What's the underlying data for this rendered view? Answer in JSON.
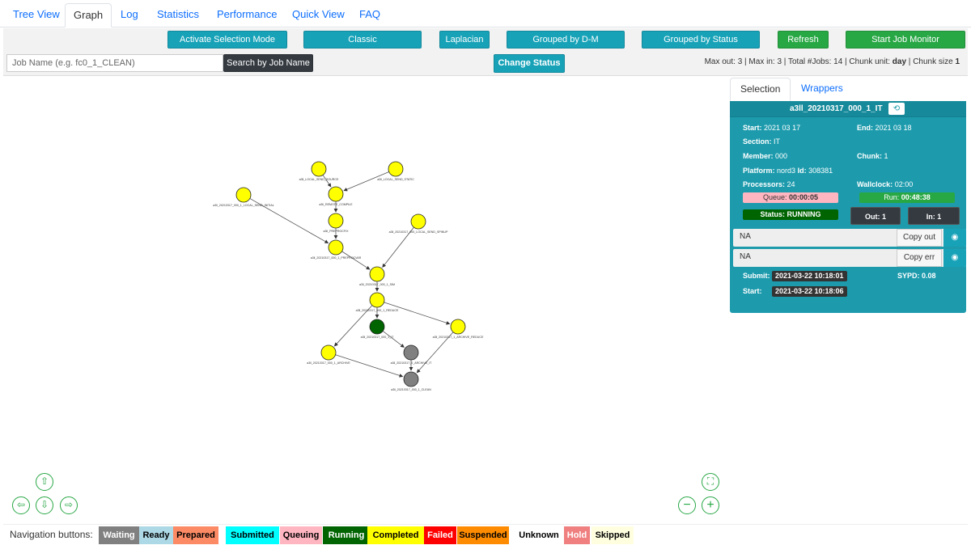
{
  "tabs": [
    "Tree View",
    "Graph",
    "Log",
    "Statistics",
    "Performance",
    "Quick View",
    "FAQ"
  ],
  "toolbar": {
    "activate_selection": "Activate Selection Mode",
    "classic": "Classic",
    "laplacian": "Laplacian",
    "grouped_dm": "Grouped by D-M",
    "grouped_status": "Grouped by Status",
    "refresh": "Refresh",
    "start_monitor": "Start Job Monitor"
  },
  "search": {
    "placeholder": "Job Name (e.g. fc0_1_CLEAN)",
    "button": "Search by Job Name",
    "change_status": "Change Status"
  },
  "info": {
    "max_out_label": "Max out:",
    "max_out": "3",
    "max_in_label": "Max in:",
    "max_in": "3",
    "total_label": "Total #Jobs:",
    "total": "14",
    "chunk_unit_label": "Chunk unit:",
    "chunk_unit": "day",
    "chunk_size_label": "Chunk size",
    "chunk_size": "1"
  },
  "side_tabs": [
    "Selection",
    "Wrappers"
  ],
  "selection": {
    "job_name": "a3ll_20210317_000_1_IT",
    "history_icon": "history-icon",
    "start_label": "Start:",
    "start": "2021 03 17",
    "end_label": "End:",
    "end": "2021 03 18",
    "section_label": "Section:",
    "section": "IT",
    "member_label": "Member:",
    "member": "000",
    "chunk_label": "Chunk:",
    "chunk": "1",
    "platform_label": "Platform:",
    "platform": "nord3",
    "id_label": "Id:",
    "id": "308381",
    "processors_label": "Processors:",
    "processors": "24",
    "wallclock_label": "Wallclock:",
    "wallclock": "02:00",
    "queue_label": "Queue:",
    "queue": "00:00:05",
    "run_label": "Run:",
    "run": "00:48:38",
    "status_label": "Status:",
    "status": "RUNNING",
    "out_label": "Out:",
    "out": "1",
    "in_label": "In:",
    "in": "1",
    "out_file": "NA",
    "copy_out": "Copy out",
    "err_file": "NA",
    "copy_err": "Copy err",
    "submit_label": "Submit:",
    "submit": "2021-03-22 10:18:01",
    "start_time_label": "Start:",
    "start_time": "2021-03-22 10:18:06",
    "sypd_label": "SYPD:",
    "sypd": "0.08"
  },
  "graph": {
    "nodes": [
      {
        "id": "n1",
        "label": "a3ll_LOCAL_SEND_SOURCE",
        "color": "#ffff00"
      },
      {
        "id": "n2",
        "label": "a3ll_LOCAL_SEND_STATIC",
        "color": "#ffff00"
      },
      {
        "id": "n3",
        "label": "a3ll_20210317_000_1_LOCAL_SEND_INITIAL",
        "color": "#ffff00"
      },
      {
        "id": "n4",
        "label": "a3ll_REMOTE_COMPILE",
        "color": "#ffff00"
      },
      {
        "id": "n5",
        "label": "a3ll_PREPROCFIX",
        "color": "#ffff00"
      },
      {
        "id": "n6",
        "label": "a3ll_20210317_000_LOCAL_SEND_SPINUP",
        "color": "#ffff00"
      },
      {
        "id": "n7",
        "label": "a3ll_20210317_000_1_PREPROCVAR",
        "color": "#ffff00"
      },
      {
        "id": "n8",
        "label": "a3ll_20210317_000_1_SIM",
        "color": "#ffff00"
      },
      {
        "id": "n9",
        "label": "a3ll_20210317_000_1_REDUCE",
        "color": "#ffff00"
      },
      {
        "id": "n10",
        "label": "a3ll_20210317_000_1_IT",
        "color": "#006400"
      },
      {
        "id": "n11",
        "label": "a3ll_20210317_1_ARCHIVE_REDUCE",
        "color": "#ffff00"
      },
      {
        "id": "n12",
        "label": "a3ll_20210317_000_1_ARCHIVE",
        "color": "#ffff00"
      },
      {
        "id": "n13",
        "label": "a3ll_20210317_0_ARCHIVE_IT",
        "color": "#808080"
      },
      {
        "id": "n14",
        "label": "a3ll_20210317_000_1_CLEAN",
        "color": "#808080"
      }
    ],
    "edges": [
      [
        "n1",
        "n4"
      ],
      [
        "n2",
        "n4"
      ],
      [
        "n4",
        "n5"
      ],
      [
        "n3",
        "n7"
      ],
      [
        "n5",
        "n7"
      ],
      [
        "n7",
        "n8"
      ],
      [
        "n6",
        "n8"
      ],
      [
        "n8",
        "n9"
      ],
      [
        "n9",
        "n10"
      ],
      [
        "n9",
        "n11"
      ],
      [
        "n9",
        "n12"
      ],
      [
        "n10",
        "n13"
      ],
      [
        "n12",
        "n14"
      ],
      [
        "n13",
        "n14"
      ],
      [
        "n11",
        "n14"
      ]
    ]
  },
  "nav": {
    "up_icon": "arrow-up-icon",
    "left_icon": "arrow-left-icon",
    "down_icon": "arrow-down-icon",
    "right_icon": "arrow-right-icon",
    "fit_icon": "fit-view-icon",
    "zoom_out_icon": "zoom-out-icon",
    "zoom_in_icon": "zoom-in-icon"
  },
  "legend": {
    "label": "Navigation buttons:",
    "statuses": [
      {
        "name": "Waiting",
        "bg": "#808080",
        "fg": "#ffffff"
      },
      {
        "name": "Ready",
        "bg": "#add8e6",
        "fg": "#000000"
      },
      {
        "name": "Prepared",
        "bg": "#fc8a64",
        "fg": "#000000"
      },
      {
        "name": "Submitted",
        "bg": "#00ffff",
        "fg": "#000000"
      },
      {
        "name": "Queuing",
        "bg": "#ffb6c1",
        "fg": "#000000"
      },
      {
        "name": "Running",
        "bg": "#006400",
        "fg": "#ffffff"
      },
      {
        "name": "Completed",
        "bg": "#ffff00",
        "fg": "#000000"
      },
      {
        "name": "Failed",
        "bg": "#ff0000",
        "fg": "#ffffff"
      },
      {
        "name": "Suspended",
        "bg": "#ff8c00",
        "fg": "#000000"
      },
      {
        "name": "Unknown",
        "bg": "#ffffff",
        "fg": "#000000"
      },
      {
        "name": "Hold",
        "bg": "#f08080",
        "fg": "#ffffff"
      },
      {
        "name": "Skipped",
        "bg": "#ffffe0",
        "fg": "#000000"
      }
    ]
  },
  "colors": {
    "teal": "#17a2b8",
    "green": "#28a745",
    "dark": "#343a40",
    "panel": "#1d9bad"
  }
}
